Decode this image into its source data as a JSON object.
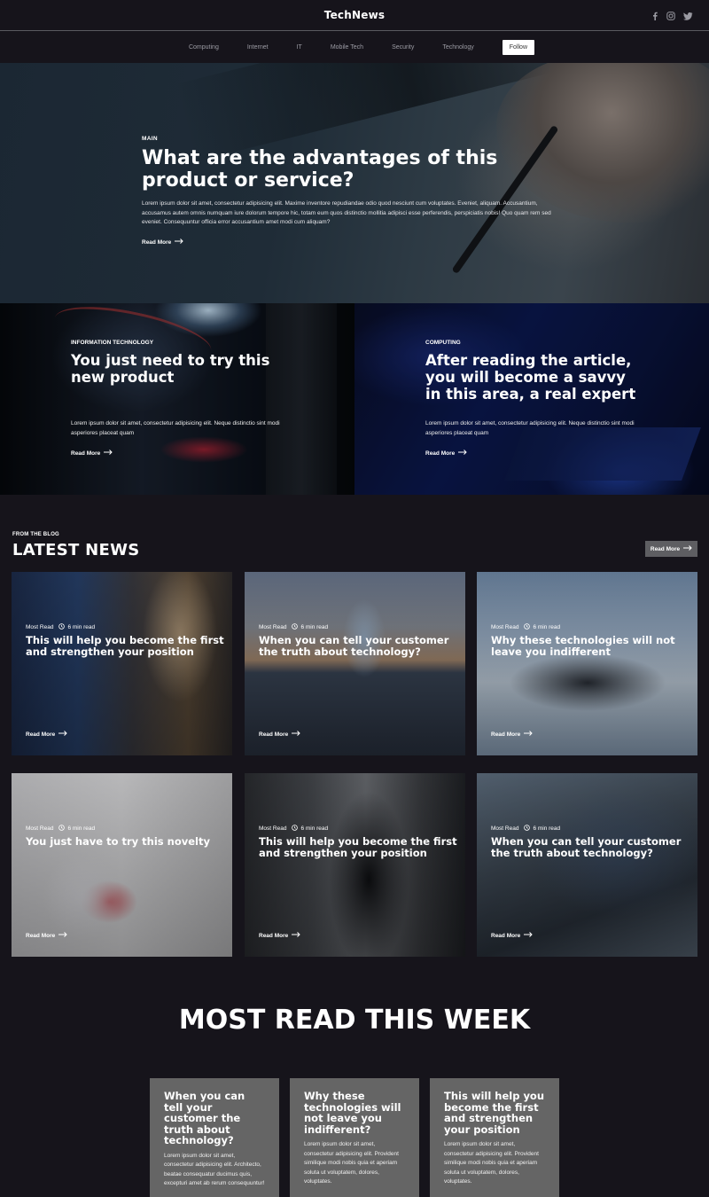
{
  "header": {
    "logo": "TechNews",
    "social": [
      "facebook-icon",
      "instagram-icon",
      "twitter-icon"
    ]
  },
  "nav": {
    "items": [
      "Computing",
      "Internet",
      "IT",
      "Mobile Tech",
      "Security",
      "Technology"
    ],
    "follow": "Follow"
  },
  "hero": {
    "label": "MAIN",
    "title": "What are the advantages of this product or service?",
    "text": "Lorem ipsum dolor sit amet, consectetur adipisicing elit. Maxime inventore repudiandae odio quod nesciunt cum voluptates. Eveniet, aliquam. Accusantium, accusamus autem omnis numquam iure dolorum tempore hic, totam eum quos distinctio mollitia adipisci esse perferendis, perspiciatis nobis! Quo quam rem sed eveniet. Consequuntur officia error accusantium amet modi cum aliquam?",
    "read_more": "Read More"
  },
  "features": [
    {
      "label": "INFORMATION TECHNOLOGY",
      "title": "You just need to try this new product",
      "text": "Lorem ipsum dolor sit amet, consectetur adipisicing elit. Neque distinctio sint modi asperiores placeat quam",
      "read_more": "Read More"
    },
    {
      "label": "COMPUTING",
      "title": "After reading the article, you will become a savvy in this area, a real expert",
      "text": "Lorem ipsum dolor sit amet, consectetur adipisicing elit. Neque distinctio sint modi asperiores placeat quam",
      "read_more": "Read More"
    }
  ],
  "latest": {
    "label": "FROM THE BLOG",
    "title": "LATEST NEWS",
    "read_more": "Read More",
    "cards": [
      {
        "category": "Most Read",
        "time": "6 min read",
        "title": "This will help you become the first and strengthen your position",
        "read_more": "Read More"
      },
      {
        "category": "Most Read",
        "time": "6 min read",
        "title": "When you can tell your customer the truth about technology?",
        "read_more": "Read More"
      },
      {
        "category": "Most Read",
        "time": "6 min read",
        "title": "Why these technologies will not leave you indifferent",
        "read_more": "Read More"
      },
      {
        "category": "Most Read",
        "time": "6 min read",
        "title": "You just have to try this novelty",
        "read_more": "Read More"
      },
      {
        "category": "Most Read",
        "time": "6 min read",
        "title": "This will help you become the first and strengthen your position",
        "read_more": "Read More"
      },
      {
        "category": "Most Read",
        "time": "6 min read",
        "title": "When you can tell your customer the truth about technology?",
        "read_more": "Read More"
      }
    ]
  },
  "most_read": {
    "title": "MOST READ THIS WEEK",
    "cards": [
      {
        "title": "When you can tell your customer the truth about technology?",
        "text": "Lorem ipsum dolor sit amet, consectetur adipisicing elit. Architecto, beatae consequatur ducimus quis, excepturi amet ab rerum consequuntur!"
      },
      {
        "title": "Why these technologies will not leave you indifferent?",
        "text": "Lorem ipsum dolor sit amet, consectetur adipisicing elit. Provident similique modi nobis quia et aperiam soluta ut voluptatem, dolores, voluptates."
      },
      {
        "title": "This will help you become the first and strengthen your position",
        "text": "Lorem ipsum dolor sit amet, consectetur adipisicing elit. Provident similique modi nobis quia et aperiam soluta ut voluptatem, dolores, voluptates."
      }
    ]
  }
}
